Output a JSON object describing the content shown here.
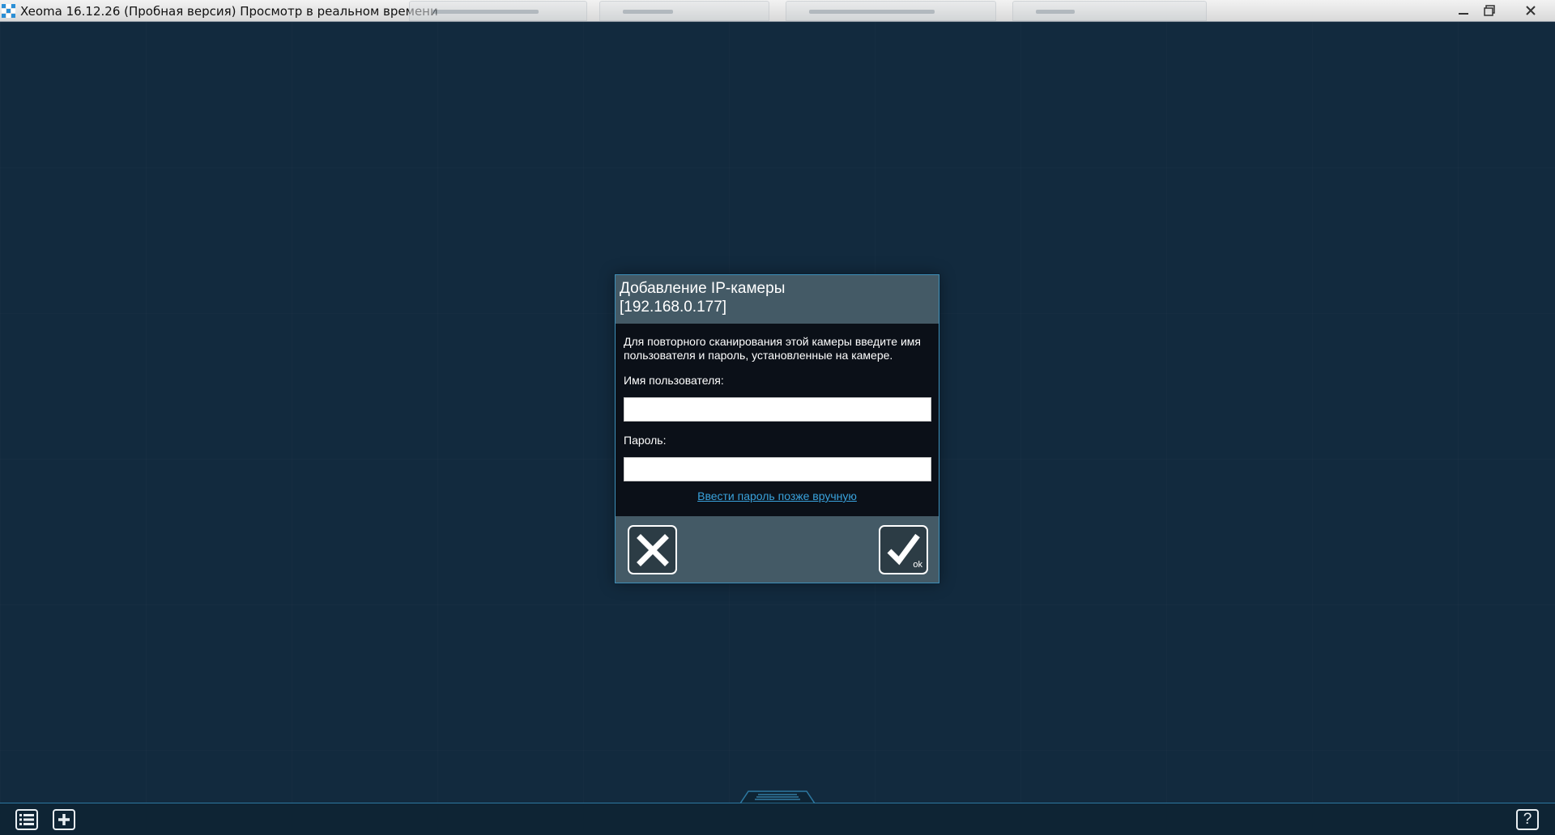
{
  "window": {
    "title": "Xeoma 16.12.26 (Пробная версия) Просмотр в реальном времени",
    "icons": {
      "app": "xeoma-app-icon",
      "minimize": "minimize-icon",
      "maximize": "maximize-icon",
      "close": "close-icon"
    }
  },
  "dialog": {
    "title_line1": "Добавление IP-камеры",
    "title_line2": "[192.168.0.177]",
    "description": "Для повторного сканирования этой камеры введите имя пользователя и пароль, установленные на камере.",
    "username_label": "Имя пользователя:",
    "username_value": "",
    "password_label": "Пароль:",
    "password_value": "",
    "enter_later_link": "Ввести пароль позже вручную",
    "ok_label": "ok",
    "cancel_icon": "x-icon",
    "ok_icon": "checkmark-icon"
  },
  "bottombar": {
    "list_icon": "list-icon",
    "add_icon": "plus-icon",
    "help_label": "?"
  },
  "colors": {
    "background": "#122a3e",
    "dialog_header": "#445a66",
    "dialog_body": "#0b1018",
    "dialog_border": "#3e8fb8",
    "link": "#39a2dc"
  }
}
